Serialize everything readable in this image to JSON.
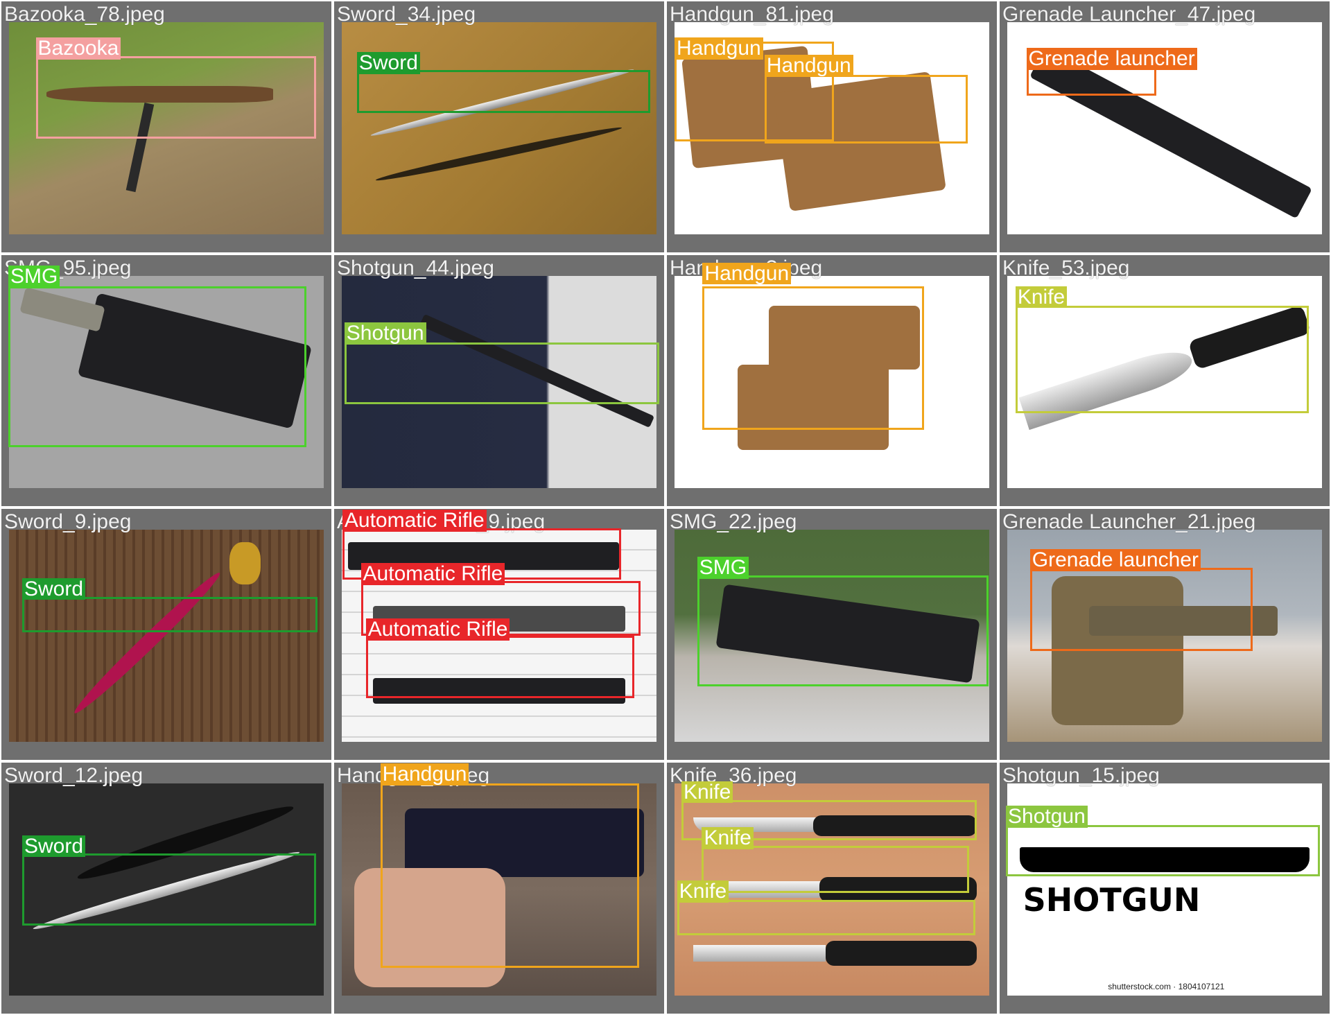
{
  "cells": [
    {
      "file": "Bazooka_78.jpeg",
      "boxes": [
        {
          "label": "Bazooka",
          "color": "#f4a0a0"
        }
      ]
    },
    {
      "file": "Sword_34.jpeg",
      "boxes": [
        {
          "label": "Sword",
          "color": "#1e9b2e"
        }
      ]
    },
    {
      "file": "Handgun_81.jpeg",
      "boxes": [
        {
          "label": "Handgun",
          "color": "#f0a51c"
        },
        {
          "label": "Handgun",
          "color": "#f0a51c"
        }
      ]
    },
    {
      "file": "Grenade Launcher_47.jpeg",
      "boxes": [
        {
          "label": "Grenade launcher",
          "color": "#ee6a1a"
        }
      ]
    },
    {
      "file": "SMG_95.jpeg",
      "boxes": [
        {
          "label": "SMG",
          "color": "#4cd12c"
        }
      ]
    },
    {
      "file": "Shotgun_44.jpeg",
      "boxes": [
        {
          "label": "Shotgun",
          "color": "#8cc63f"
        }
      ]
    },
    {
      "file": "Handgun_?.jpeg",
      "boxes": [
        {
          "label": "Handgun",
          "color": "#f0a51c"
        }
      ]
    },
    {
      "file": "Knife_53.jpeg",
      "boxes": [
        {
          "label": "Knife",
          "color": "#c3cc3a"
        }
      ]
    },
    {
      "file": "Sword_9.jpeg",
      "boxes": [
        {
          "label": "Sword",
          "color": "#1e9b2e"
        }
      ]
    },
    {
      "file": "Automatic Rifle_9.jpeg",
      "boxes": [
        {
          "label": "Automatic Rifle",
          "color": "#e8262a"
        },
        {
          "label": "Automatic Rifle",
          "color": "#e8262a"
        },
        {
          "label": "Automatic Rifle",
          "color": "#e8262a"
        }
      ]
    },
    {
      "file": "SMG_22.jpeg",
      "boxes": [
        {
          "label": "SMG",
          "color": "#4cd12c"
        }
      ]
    },
    {
      "file": "Grenade Launcher_21.jpeg",
      "boxes": [
        {
          "label": "Grenade launcher",
          "color": "#ee6a1a"
        }
      ]
    },
    {
      "file": "Sword_12.jpeg",
      "boxes": [
        {
          "label": "Sword",
          "color": "#1e9b2e"
        }
      ]
    },
    {
      "file": "Handgun_?.jpeg",
      "boxes": [
        {
          "label": "Handgun",
          "color": "#f0a51c"
        }
      ]
    },
    {
      "file": "Knife_36.jpeg",
      "boxes": [
        {
          "label": "Knife",
          "color": "#c3cc3a"
        },
        {
          "label": "Knife",
          "color": "#c3cc3a"
        },
        {
          "label": "Knife",
          "color": "#c3cc3a"
        }
      ]
    },
    {
      "file": "Shotgun_15.jpeg",
      "boxes": [
        {
          "label": "Shotgun",
          "color": "#8cc63f"
        }
      ]
    }
  ],
  "image_text": {
    "shotgun_caption": "SHOTGUN",
    "shutterstock": "shutterstock.com · 1804107121"
  }
}
